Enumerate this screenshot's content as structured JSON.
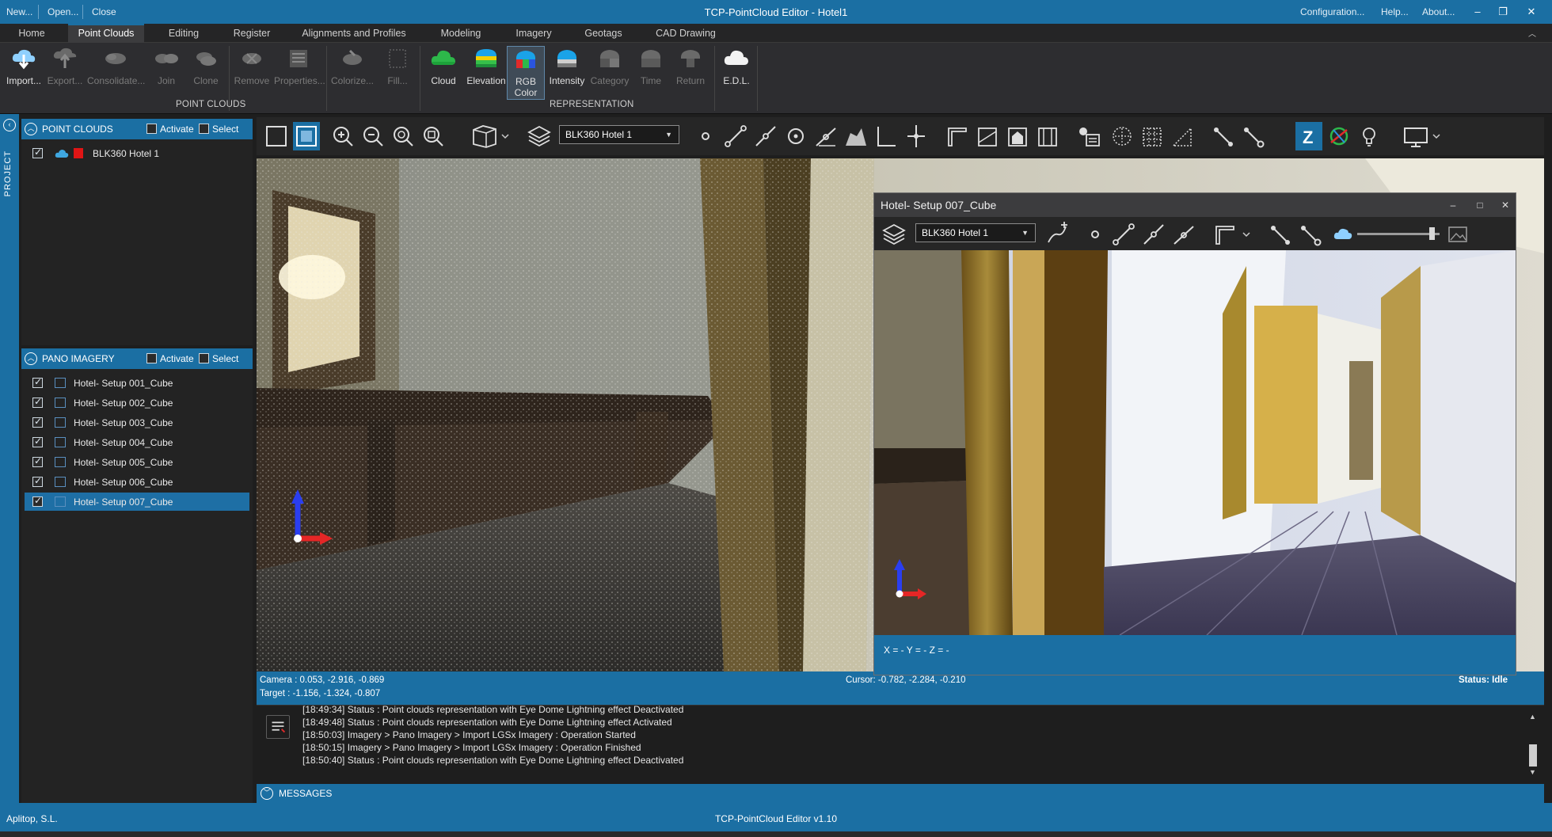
{
  "titlebar": {
    "quick_actions": [
      "New...",
      "Open...",
      "Close"
    ],
    "title": "TCP-PointCloud Editor - Hotel1",
    "right_links": [
      "Configuration...",
      "Help...",
      "About..."
    ],
    "window_controls": [
      "minimize-icon",
      "restore-icon",
      "close-icon"
    ]
  },
  "ribbon": {
    "tabs": [
      "Home",
      "Point Clouds",
      "Editing",
      "Register",
      "Alignments and Profiles",
      "Modeling",
      "Imagery",
      "Geotags",
      "CAD Drawing"
    ],
    "active_tab": "Point Clouds",
    "point_clouds_group": {
      "label": "POINT CLOUDS",
      "buttons": [
        {
          "label": "Import...",
          "icon": "import-cloud-icon",
          "enabled": true
        },
        {
          "label": "Export...",
          "icon": "export-cloud-icon",
          "enabled": false
        },
        {
          "label": "Consolidate...",
          "icon": "consolidate-icon",
          "enabled": false
        },
        {
          "label": "Join",
          "icon": "join-icon",
          "enabled": false
        },
        {
          "label": "Clone",
          "icon": "clone-icon",
          "enabled": false
        },
        {
          "label": "Remove",
          "icon": "remove-icon",
          "enabled": false
        },
        {
          "label": "Properties...",
          "icon": "properties-icon",
          "enabled": false
        },
        {
          "label": "Colorize...",
          "icon": "colorize-icon",
          "enabled": false
        },
        {
          "label": "Fill...",
          "icon": "fill-icon",
          "enabled": false
        }
      ]
    },
    "representation_group": {
      "label": "REPRESENTATION",
      "buttons": [
        {
          "label": "Cloud",
          "icon": "cloud-icon",
          "enabled": true
        },
        {
          "label": "Elevation",
          "icon": "elevation-icon",
          "enabled": true
        },
        {
          "label": "RGB Color",
          "line1": "RGB",
          "line2": "Color",
          "icon": "rgb-color-icon",
          "enabled": true,
          "selected": true
        },
        {
          "label": "Intensity",
          "icon": "intensity-icon",
          "enabled": true
        },
        {
          "label": "Category",
          "icon": "category-icon",
          "enabled": false
        },
        {
          "label": "Time",
          "icon": "time-icon",
          "enabled": false
        },
        {
          "label": "Return",
          "icon": "return-icon",
          "enabled": false
        },
        {
          "label": "E.D.L.",
          "icon": "edl-icon",
          "enabled": true
        }
      ]
    }
  },
  "sidebar": {
    "strip_label": "PROJECT",
    "point_clouds": {
      "title": "POINT CLOUDS",
      "activate_label": "Activate",
      "select_label": "Select",
      "items": [
        {
          "label": "BLK360 Hotel 1",
          "checked": true,
          "color": "#e01515"
        }
      ]
    },
    "pano_imagery": {
      "title": "PANO IMAGERY",
      "activate_label": "Activate",
      "select_label": "Select",
      "items": [
        {
          "label": "Hotel- Setup 001_Cube",
          "checked": true
        },
        {
          "label": "Hotel- Setup 002_Cube",
          "checked": true
        },
        {
          "label": "Hotel- Setup 003_Cube",
          "checked": true
        },
        {
          "label": "Hotel- Setup 004_Cube",
          "checked": true
        },
        {
          "label": "Hotel- Setup 005_Cube",
          "checked": true
        },
        {
          "label": "Hotel- Setup 006_Cube",
          "checked": true
        },
        {
          "label": "Hotel- Setup 007_Cube",
          "checked": true,
          "selected": true
        }
      ]
    }
  },
  "toolbar": {
    "layer_select_value": "BLK360 Hotel 1"
  },
  "viewport": {
    "camera": "Camera : 0.053, -2.916, -0.869",
    "target": "Target : -1.156, -1.324, -0.807",
    "cursor": "Cursor: -0.782, -2.284, -0.210",
    "status": "Status: Idle"
  },
  "pano_window": {
    "title": "Hotel- Setup 007_Cube",
    "layer_select_value": "BLK360 Hotel 1",
    "slider_value": 0.9,
    "coords": "X = -  Y = -  Z = -"
  },
  "messages": {
    "lines": [
      "[18:49:34] Status : Point clouds representation with Eye Dome Lightning effect Deactivated",
      "[18:49:48] Status : Point clouds representation with Eye Dome Lightning effect Activated",
      "[18:50:03] Imagery > Pano Imagery > Import LGSx Imagery : Operation Started",
      "[18:50:15] Imagery > Pano Imagery > Import LGSx Imagery : Operation Finished",
      "[18:50:40] Status : Point clouds representation with Eye Dome Lightning effect Deactivated"
    ],
    "footer_label": "MESSAGES"
  },
  "footer": {
    "company": "Aplitop, S.L.",
    "version": "TCP-PointCloud Editor v1.10"
  },
  "colors": {
    "accent": "#1b6fa3",
    "ribbon_bg": "#2d2d30",
    "panel_bg": "#232323",
    "selection": "#1e6fa5"
  }
}
